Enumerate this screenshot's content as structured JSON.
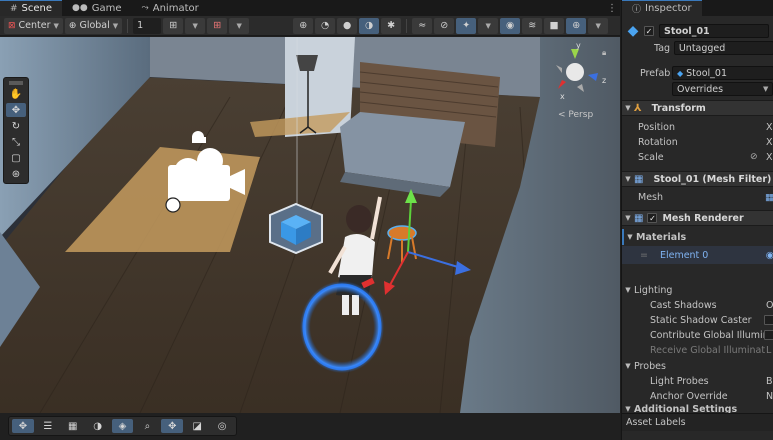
{
  "tabs": [
    {
      "label": "Scene",
      "icon": "grid-icon"
    },
    {
      "label": "Game",
      "icon": "gamepad-icon"
    },
    {
      "label": "Animator",
      "icon": "animator-icon"
    }
  ],
  "scene_toolbar": {
    "pivot_label": "Center",
    "space_label": "Global",
    "grid_value": "1",
    "overlay_icons": [
      "view-options-icon",
      "render-mode-icon",
      "shading-icon",
      "lighting-icon"
    ]
  },
  "viewport": {
    "persp_label": "Persp",
    "gizmo_axes": {
      "x": "x",
      "y": "y",
      "z": "z"
    }
  },
  "inspector": {
    "tab_label": "Inspector",
    "object_name": "Stool_01",
    "tag_label": "Tag",
    "tag_value": "Untagged",
    "prefab_label": "Prefab",
    "prefab_value": "Stool_01",
    "overrides_label": "Overrides",
    "transform": {
      "title": "Transform",
      "position": "Position",
      "rotation": "Rotation",
      "scale": "Scale",
      "x_label": "X"
    },
    "mesh_filter": {
      "title": "Stool_01 (Mesh Filter)",
      "mesh_label": "Mesh"
    },
    "mesh_renderer": {
      "title": "Mesh Renderer",
      "materials_label": "Materials",
      "element_label": "Element 0"
    },
    "lighting": {
      "title": "Lighting",
      "cast_shadows": "Cast Shadows",
      "cast_shadows_value": "O",
      "static_shadow": "Static Shadow Caster",
      "contribute_gi": "Contribute Global Illuminat",
      "receive_gi": "Receive Global Illumination",
      "receive_gi_value": "L"
    },
    "probes": {
      "title": "Probes",
      "light_probes": "Light Probes",
      "light_probes_value": "B",
      "anchor_override": "Anchor Override",
      "anchor_override_value": "N"
    },
    "additional_settings": "Additional Settings",
    "asset_labels": "Asset Labels"
  }
}
